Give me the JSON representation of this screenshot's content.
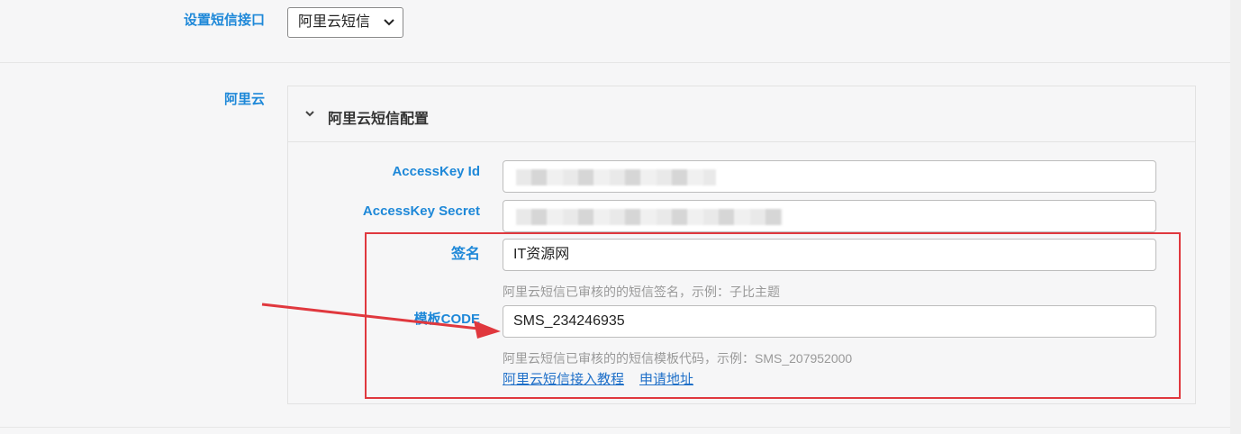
{
  "sms_interface": {
    "label": "设置短信接口",
    "selected": "阿里云短信"
  },
  "aliyun": {
    "label": "阿里云",
    "panel_title": "阿里云短信配置",
    "access_key_id": {
      "label": "AccessKey Id"
    },
    "access_key_secret": {
      "label": "AccessKey Secret"
    },
    "sign_name": {
      "label": "签名",
      "value": "IT资源网",
      "help": "阿里云短信已审核的的短信签名，示例：子比主题"
    },
    "template_code": {
      "label": "模板CODE",
      "value": "SMS_234246935",
      "help": "阿里云短信已审核的的短信模板代码，示例：SMS_207952000"
    },
    "links": {
      "tutorial": "阿里云短信接入教程",
      "apply": "申请地址"
    }
  },
  "colors": {
    "label_blue": "#1e88d8",
    "highlight_red": "#e0383e",
    "link_blue": "#1e6fc8"
  }
}
